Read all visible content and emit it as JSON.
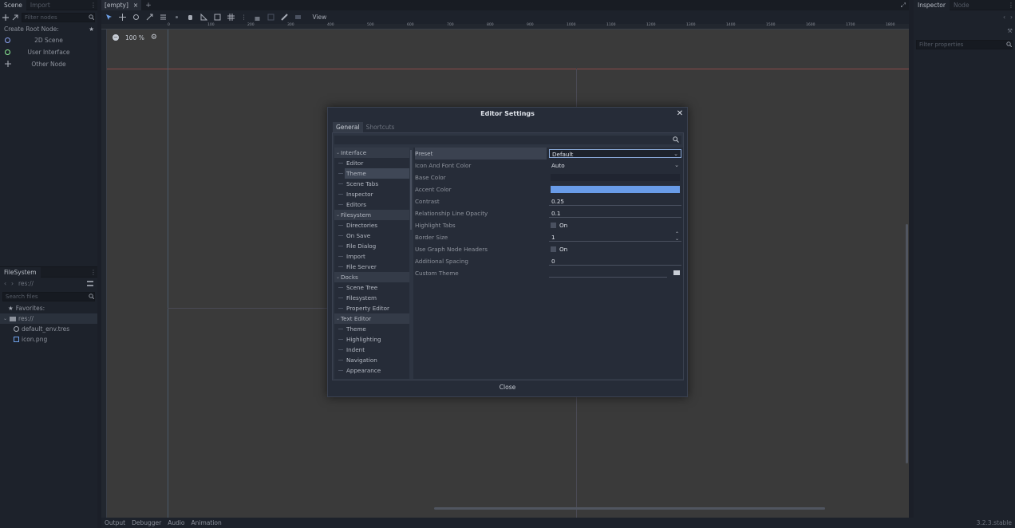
{
  "left_dock": {
    "tabs": [
      "Scene",
      "Import"
    ],
    "filter_placeholder": "Filter nodes",
    "create_root_title": "Create Root Node:",
    "root_options": [
      {
        "label": "2D Scene",
        "icon": "node2d-circle-icon",
        "color": "#8da5f3"
      },
      {
        "label": "User Interface",
        "icon": "control-circle-icon",
        "color": "#8eef97"
      },
      {
        "label": "Other Node",
        "icon": "plus-icon",
        "color": "#a6abb5"
      }
    ]
  },
  "filesystem": {
    "title": "FileSystem",
    "path": "res://",
    "search_placeholder": "Search files",
    "favorites": "Favorites:",
    "root": "res://",
    "files": [
      {
        "name": "default_env.tres",
        "icon": "environment-icon"
      },
      {
        "name": "icon.png",
        "icon": "image-icon"
      }
    ]
  },
  "main": {
    "scene_tab": "[empty]",
    "view_menu": "View",
    "zoom": "100 %",
    "ruler_ticks": [
      "0",
      "100",
      "200",
      "300",
      "400",
      "500",
      "600",
      "700",
      "800",
      "900",
      "1000",
      "1100",
      "1200",
      "1300",
      "1400",
      "1500",
      "1600",
      "1700",
      "1800"
    ]
  },
  "bottom_bar": {
    "tabs": [
      "Output",
      "Debugger",
      "Audio",
      "Animation"
    ],
    "version": "3.2.3.stable"
  },
  "inspector": {
    "tabs": [
      "Inspector",
      "Node"
    ],
    "filter_placeholder": "Filter properties"
  },
  "dialog": {
    "title": "Editor Settings",
    "tabs": [
      "General",
      "Shortcuts"
    ],
    "close_button": "Close",
    "tree": [
      {
        "label": "Interface",
        "type": "section"
      },
      {
        "label": "Editor",
        "type": "child"
      },
      {
        "label": "Theme",
        "type": "child",
        "selected": true
      },
      {
        "label": "Scene Tabs",
        "type": "child"
      },
      {
        "label": "Inspector",
        "type": "child"
      },
      {
        "label": "Editors",
        "type": "child"
      },
      {
        "label": "Filesystem",
        "type": "section"
      },
      {
        "label": "Directories",
        "type": "child"
      },
      {
        "label": "On Save",
        "type": "child"
      },
      {
        "label": "File Dialog",
        "type": "child"
      },
      {
        "label": "Import",
        "type": "child"
      },
      {
        "label": "File Server",
        "type": "child"
      },
      {
        "label": "Docks",
        "type": "section"
      },
      {
        "label": "Scene Tree",
        "type": "child"
      },
      {
        "label": "Filesystem",
        "type": "child"
      },
      {
        "label": "Property Editor",
        "type": "child"
      },
      {
        "label": "Text Editor",
        "type": "section"
      },
      {
        "label": "Theme",
        "type": "child"
      },
      {
        "label": "Highlighting",
        "type": "child"
      },
      {
        "label": "Indent",
        "type": "child"
      },
      {
        "label": "Navigation",
        "type": "child"
      },
      {
        "label": "Appearance",
        "type": "child"
      }
    ],
    "properties": {
      "preset": {
        "label": "Preset",
        "value": "Default"
      },
      "icon_font_color": {
        "label": "Icon And Font Color",
        "value": "Auto"
      },
      "base_color": {
        "label": "Base Color",
        "color": "#202531"
      },
      "accent_color": {
        "label": "Accent Color",
        "color": "#699ce8"
      },
      "contrast": {
        "label": "Contrast",
        "value": "0.25"
      },
      "relationship_line_opacity": {
        "label": "Relationship Line Opacity",
        "value": "0.1"
      },
      "highlight_tabs": {
        "label": "Highlight Tabs",
        "value": "On"
      },
      "border_size": {
        "label": "Border Size",
        "value": "1"
      },
      "use_graph_node_headers": {
        "label": "Use Graph Node Headers",
        "value": "On"
      },
      "additional_spacing": {
        "label": "Additional Spacing",
        "value": "0"
      },
      "custom_theme": {
        "label": "Custom Theme",
        "value": ""
      }
    }
  }
}
